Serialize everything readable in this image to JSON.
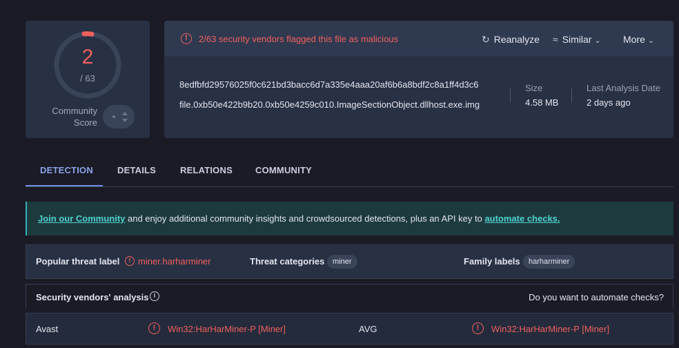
{
  "score": {
    "detections": "2",
    "total": "/ 63",
    "community_label": "Community Score"
  },
  "alert": {
    "text": "2/63 security vendors flagged this file as malicious"
  },
  "actions": {
    "reanalyze": "Reanalyze",
    "similar": "Similar",
    "more": "More"
  },
  "file": {
    "hash": "8edfbfd29576025f0c621bd3bacc6d7a335e4aaa20af6b6a8bdf2c8a1ff4d3c6",
    "name": "file.0xb50e422b9b20.0xb50e4259c010.ImageSectionObject.dllhost.exe.img",
    "size_label": "Size",
    "size_value": "4.58 MB",
    "last_analysis_label": "Last Analysis Date",
    "last_analysis_value": "2 days ago"
  },
  "tabs": [
    {
      "label": "DETECTION"
    },
    {
      "label": "DETAILS"
    },
    {
      "label": "RELATIONS"
    },
    {
      "label": "COMMUNITY"
    }
  ],
  "banner": {
    "link1": "Join our Community",
    "middle": " and enjoy additional community insights and crowdsourced detections, plus an API key to ",
    "link2": "automate checks."
  },
  "threat": {
    "popular_label": "Popular threat label",
    "popular_value": "miner.harharminer",
    "categories_label": "Threat categories",
    "categories_tag": "miner",
    "family_label": "Family labels",
    "family_tag": "harharminer"
  },
  "vendors": {
    "title": "Security vendors' analysis",
    "automate_prompt": "Do you want to automate checks?",
    "rows": [
      {
        "vendor1": "Avast",
        "result1": "Win32:HarHarMiner-P [Miner]",
        "vendor2": "AVG",
        "result2": "Win32:HarHarMiner-P [Miner]"
      }
    ]
  },
  "colors": {
    "malicious": "#f0605c",
    "accent": "#6f8fe0",
    "link": "#4fd1cf"
  }
}
